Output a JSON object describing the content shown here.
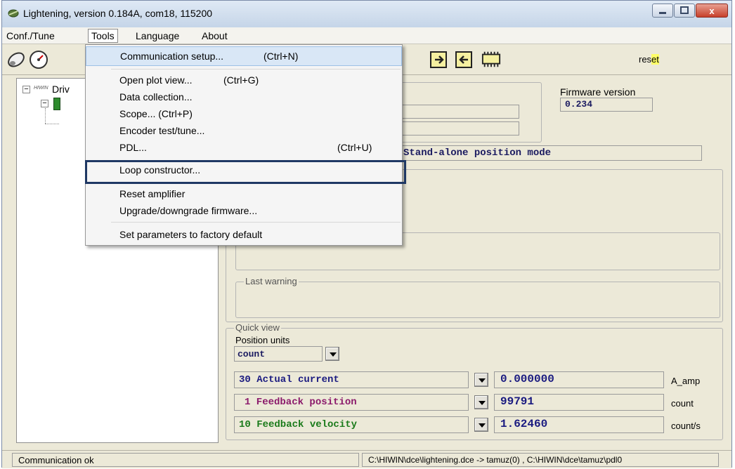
{
  "window": {
    "title": "Lightening, version 0.184A, com18, 115200",
    "close_label": "x"
  },
  "menubar": {
    "items": [
      "Conf./Tune",
      "Tools",
      "Language",
      "About"
    ]
  },
  "toolbar": {
    "reset_label": "reset"
  },
  "tree": {
    "root_label": "Driv",
    "logo_text": "HIWIN"
  },
  "firmware": {
    "label": "Firmware version",
    "value": "0.234"
  },
  "mode": {
    "value": "Stand-alone position mode"
  },
  "warning": {
    "label": "Last warning"
  },
  "quick_view": {
    "label": "Quick view",
    "position_units_label": "Position units",
    "position_units_value": "count",
    "rows": [
      {
        "name": "30 Actual current",
        "value": "0.000000",
        "unit": "A_amp",
        "color": "#1a1a80"
      },
      {
        "name": "1 Feedback position",
        "value": "99791",
        "unit": "count",
        "color": "#8b1a6b"
      },
      {
        "name": "10 Feedback velocity",
        "value": "1.62460",
        "unit": "count/s",
        "color": "#1a7a1a"
      }
    ]
  },
  "tools_menu": {
    "items": [
      {
        "label": "Communication setup...",
        "shortcut": "(Ctrl+N)"
      },
      {
        "label": "Open plot view...",
        "shortcut": "(Ctrl+G)"
      },
      {
        "label": "Data collection...",
        "shortcut": ""
      },
      {
        "label": "Scope... (Ctrl+P)",
        "shortcut": ""
      },
      {
        "label": "Encoder test/tune...",
        "shortcut": ""
      },
      {
        "label": "PDL...",
        "shortcut": "(Ctrl+U)"
      },
      {
        "label": "Loop constructor...",
        "shortcut": ""
      },
      {
        "label": "Reset amplifier",
        "shortcut": ""
      },
      {
        "label": "Upgrade/downgrade firmware...",
        "shortcut": ""
      },
      {
        "label": "Set parameters to factory default",
        "shortcut": ""
      }
    ]
  },
  "statusbar": {
    "status": "Communication ok",
    "path": "C:\\HIWIN\\dce\\lightening.dce -> tamuz(0) , C:\\HIWIN\\dce\\tamuz\\pdl0"
  },
  "colors": {
    "accent_outline": "#1f3864",
    "reset_highlight": "#ffff66"
  }
}
